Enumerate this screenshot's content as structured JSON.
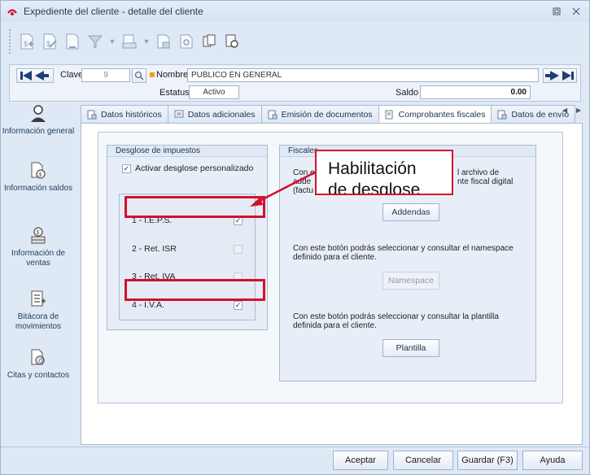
{
  "window": {
    "title": "Expediente del cliente - detalle del cliente"
  },
  "toolbar": {
    "buttons": [
      "new-record-icon",
      "edit-record-icon",
      "copy-record-icon",
      "filter-icon",
      "print-icon",
      "export-icon",
      "search-icon",
      "attach-icon",
      "settings-icon"
    ]
  },
  "record": {
    "clave_label": "Clave",
    "clave_value": "9",
    "nombre_label": "Nombre",
    "nombre_value": "PUBLICO EN GENERAL",
    "estatus_label": "Estatus",
    "estatus_value": "Activo",
    "saldo_label": "Saldo",
    "saldo_value": "0.00"
  },
  "sidebar": {
    "items": [
      {
        "label": "Información general"
      },
      {
        "label": "Información saldos"
      },
      {
        "label": "Información de ventas"
      },
      {
        "label": "Bitácora de movimientos"
      },
      {
        "label": "Citas y contactos"
      }
    ]
  },
  "tabs": [
    {
      "label": "Datos históricos"
    },
    {
      "label": "Datos adicionales"
    },
    {
      "label": "Emisión de documentos"
    },
    {
      "label": "Comprobantes fiscales"
    },
    {
      "label": "Datos de envío"
    }
  ],
  "desglose": {
    "title": "Desglose de impuestos",
    "personalizado_label": "Activar desglose personalizado",
    "personalizado_checked": true,
    "rows": [
      {
        "label": "1 - I.E.P.S.",
        "checked": true,
        "enabled": true
      },
      {
        "label": "2 - Ret. ISR",
        "checked": false,
        "enabled": false
      },
      {
        "label": "3 - Ret. IVA",
        "checked": false,
        "enabled": false
      },
      {
        "label": "4 - I.V.A.",
        "checked": true,
        "enabled": true
      }
    ]
  },
  "fiscales": {
    "title": "Fiscales",
    "addendas_desc": "Con este botón podrás seleccionar y consultar el archivo de addenda que se agregará al comprobante fiscal digital (factura) para el cliente.",
    "addendas_desc_visible": [
      "Con es",
      "l archivo de",
      "adde",
      "nte fiscal digital",
      "(factu"
    ],
    "addendas_button": "Addendas",
    "namespace_desc": "Con este botón podrás seleccionar y consultar el namespace definido para el cliente.",
    "namespace_button": "Namespace",
    "plantilla_desc": "Con este botón podrás seleccionar y consultar la plantilla definida para el cliente.",
    "plantilla_button": "Plantilla"
  },
  "callout": {
    "line1": "Habilitación",
    "line2": "de desglose"
  },
  "footer": {
    "aceptar": "Aceptar",
    "cancelar": "Cancelar",
    "guardar": "Guardar (F3)",
    "ayuda": "Ayuda"
  },
  "colors": {
    "highlight": "#d4102e",
    "accent": "#f2a21b"
  }
}
